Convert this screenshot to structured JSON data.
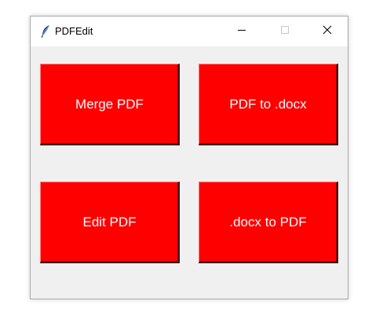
{
  "window": {
    "title": "PDFEdit",
    "icon": "feather-icon",
    "controls": {
      "minimize": "minimize-icon",
      "maximize": "maximize-icon",
      "close": "close-icon"
    }
  },
  "buttons": {
    "merge_pdf": "Merge PDF",
    "pdf_to_docx": "PDF to .docx",
    "edit_pdf": "Edit PDF",
    "docx_to_pdf": ".docx to PDF"
  },
  "colors": {
    "button_bg": "#ff0000",
    "button_text": "#ffffff",
    "window_bg": "#f0f0f0"
  }
}
